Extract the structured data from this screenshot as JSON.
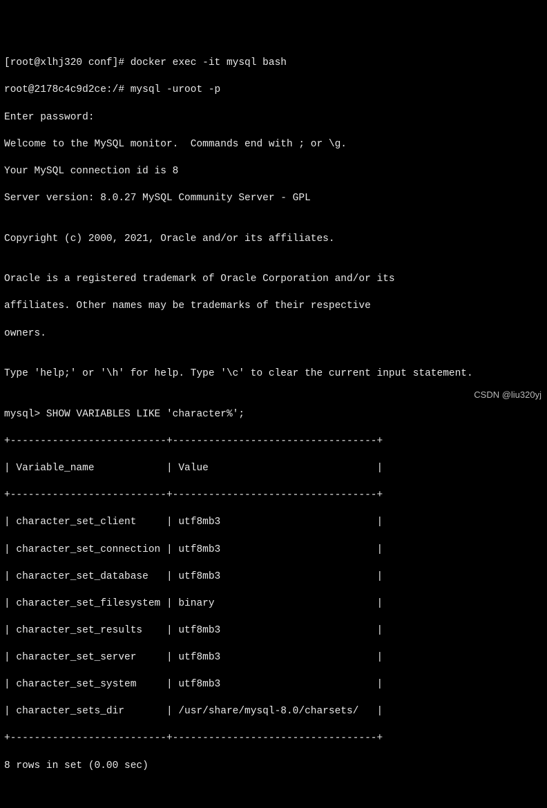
{
  "lines": {
    "l1": "[root@xlhj320 conf]# docker exec -it mysql bash",
    "l2": "root@2178c4c9d2ce:/# mysql -uroot -p",
    "l3": "Enter password:",
    "l4": "Welcome to the MySQL monitor.  Commands end with ; or \\g.",
    "l5": "Your MySQL connection id is 8",
    "l6": "Server version: 8.0.27 MySQL Community Server - GPL",
    "l7": "",
    "l8": "Copyright (c) 2000, 2021, Oracle and/or its affiliates.",
    "l9": "",
    "l10": "Oracle is a registered trademark of Oracle Corporation and/or its",
    "l11": "affiliates. Other names may be trademarks of their respective",
    "l12": "owners.",
    "l13": "",
    "l14": "Type 'help;' or '\\h' for help. Type '\\c' to clear the current input statement.",
    "l15": "",
    "l16": "mysql> SHOW VARIABLES LIKE 'character%';"
  },
  "table": {
    "border_top": "+--------------------------+----------------------------------+",
    "header": "| Variable_name            | Value                            |",
    "border_mid": "+--------------------------+----------------------------------+",
    "rows": {
      "r1": "| character_set_client     | utf8mb3                          |",
      "r2": "| character_set_connection | utf8mb3                          |",
      "r3": "| character_set_database   | utf8mb3                          |",
      "r4": "| character_set_filesystem | binary                           |",
      "r5": "| character_set_results    | utf8mb3                          |",
      "r6": "| character_set_server     | utf8mb3                          |",
      "r7": "| character_set_system     | utf8mb3                          |",
      "r8": "| character_sets_dir       | /usr/share/mysql-8.0/charsets/   |"
    },
    "border_bottom": "+--------------------------+----------------------------------+",
    "summary": "8 rows in set (0.00 sec)"
  },
  "chart_data": {
    "type": "table",
    "title": "SHOW VARIABLES LIKE 'character%'",
    "columns": [
      "Variable_name",
      "Value"
    ],
    "rows": [
      [
        "character_set_client",
        "utf8mb3"
      ],
      [
        "character_set_connection",
        "utf8mb3"
      ],
      [
        "character_set_database",
        "utf8mb3"
      ],
      [
        "character_set_filesystem",
        "binary"
      ],
      [
        "character_set_results",
        "utf8mb3"
      ],
      [
        "character_set_server",
        "utf8mb3"
      ],
      [
        "character_set_system",
        "utf8mb3"
      ],
      [
        "character_sets_dir",
        "/usr/share/mysql-8.0/charsets/"
      ]
    ]
  },
  "watermark": "CSDN @liu320yj"
}
